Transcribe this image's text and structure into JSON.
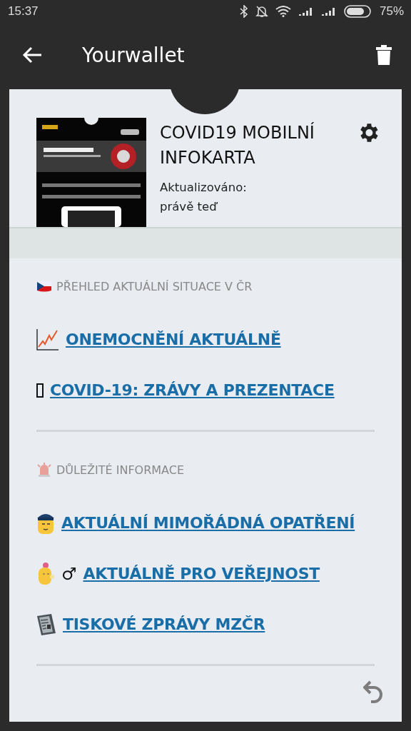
{
  "status_bar": {
    "time": "15:37",
    "battery": "75%"
  },
  "app_bar": {
    "title": "Yourwallet"
  },
  "card": {
    "title": "COVID19 MOBILNÍ INFOKARTA",
    "updated_label": "Aktualizováno:",
    "updated_value": "právě teď"
  },
  "sections": [
    {
      "heading": "PŘEHLED AKTUÁLNÍ SITUACE V ČR",
      "links": [
        {
          "text": "ONEMOCNĚNÍ AKTUÁLNĚ"
        },
        {
          "text": "COVID-19: ZRÁVY A PREZENTACE"
        }
      ]
    },
    {
      "heading": "DŮLEŽITÉ INFORMACE",
      "links": [
        {
          "text": "AKTUÁLNÍ MIMOŘÁDNÁ OPATŘENÍ"
        },
        {
          "symbol": "♂",
          "text": "AKTUÁLNĚ PRO VEŘEJNOST"
        },
        {
          "text": "TISKOVÉ ZPRÁVY MZČR"
        }
      ]
    }
  ]
}
